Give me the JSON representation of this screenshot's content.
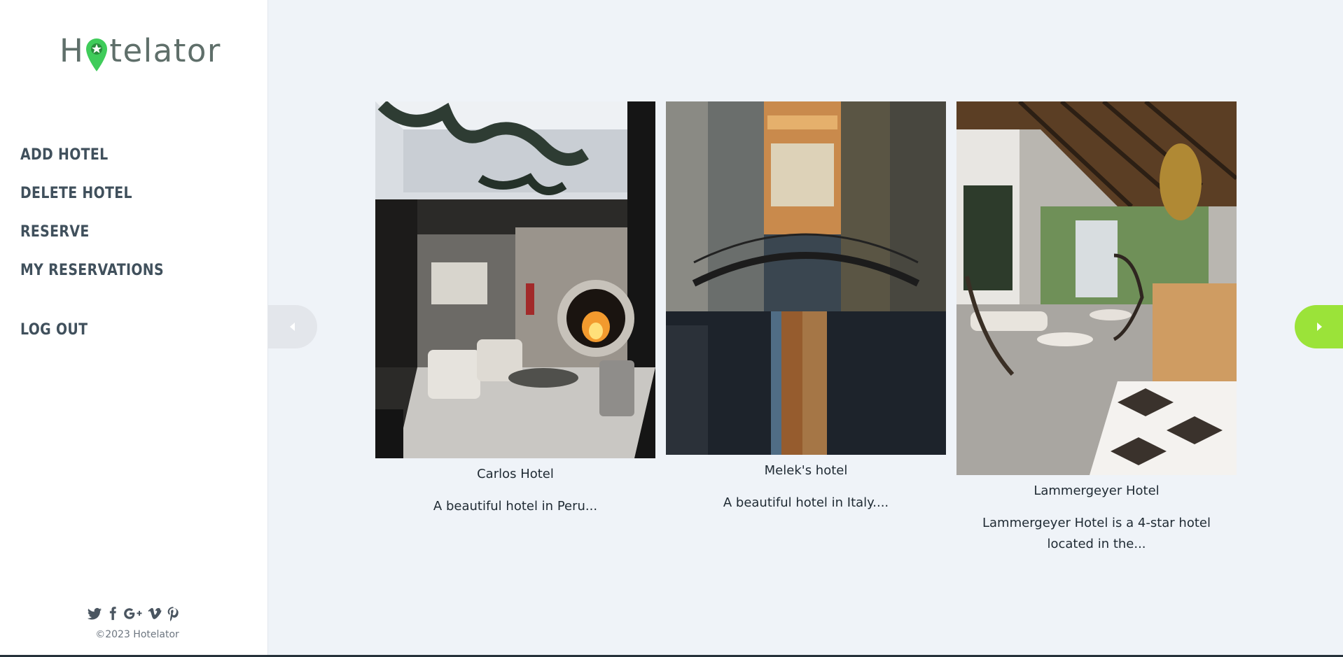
{
  "sidebar": {
    "logo_text_before": "H",
    "logo_text_after": "telator",
    "nav": [
      {
        "label": "Add Hotel"
      },
      {
        "label": "Delete Hotel"
      },
      {
        "label": "Reserve"
      },
      {
        "label": "My Reservations"
      },
      {
        "label": "Log Out"
      }
    ],
    "social_icons": [
      "twitter-icon",
      "facebook-icon",
      "google-plus-icon",
      "vimeo-icon",
      "pinterest-icon"
    ],
    "copyright": "©2023 Hotelator"
  },
  "carousel": {
    "hotels": [
      {
        "name": "Carlos Hotel",
        "description": "A beautiful hotel in Peru..."
      },
      {
        "name": "Melek's hotel",
        "description": "A beautiful hotel in Italy...."
      },
      {
        "name": "Lammergeyer Hotel",
        "description": "Lammergeyer Hotel is a 4-star hotel located in the..."
      }
    ]
  },
  "colors": {
    "accent": "#9be339",
    "logo_pin": "#3fcc5a",
    "text": "#40505c",
    "background": "#eff3f8"
  }
}
